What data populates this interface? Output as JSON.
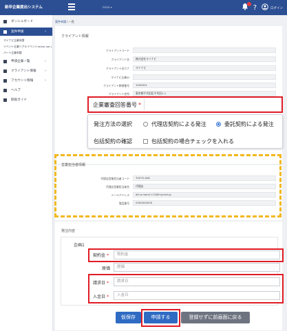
{
  "header": {
    "app_title": "新卒企業提出システム",
    "center_text": "mirai ▾",
    "help_icon": "?",
    "user_label": "ログイン"
  },
  "sidebar": {
    "items": [
      {
        "label": "ダッシュボード",
        "chevron": ""
      },
      {
        "label": "案件申請",
        "chevron": "‹"
      }
    ],
    "subitems": [
      "マイナビ企業申請",
      "イベント企業リアルイベント(mirai ver.)",
      "パート企業申請"
    ],
    "items2": [
      {
        "label": "申請企業一覧",
        "chevron": "›"
      },
      {
        "label": "クライアント情報",
        "chevron": "›"
      },
      {
        "label": "アカウント情報",
        "chevron": "›"
      },
      {
        "label": "ヘルプ",
        "chevron": ""
      },
      {
        "label": "取扱ガイド",
        "chevron": ""
      }
    ]
  },
  "breadcrumb": {
    "link": "案件申請",
    "sep": " / ",
    "current": "一覧"
  },
  "client_section": {
    "title": "クライアント情報",
    "rows": [
      {
        "label": "クライアントコード",
        "value": ""
      },
      {
        "label": "クライアント名",
        "value": "株式会社マイナビ"
      },
      {
        "label": "クライアント名カナ",
        "value": "マイナビ"
      },
      {
        "label": "マイナビ企業ID",
        "value": ""
      },
      {
        "label": "クライアント郵便番号",
        "value": "1000001"
      },
      {
        "label": "クライアント住所",
        "value": "東京都千代田区千代田1-1"
      }
    ]
  },
  "zoom_company": {
    "label": "企業審査回答番号",
    "required": "*"
  },
  "zoom_order": {
    "method_label": "発注方法の選択",
    "option_agency": "代理店契約による発注",
    "option_commission": "委託契約による発注",
    "bulk_label": "包括契約の確認",
    "bulk_checkbox": "包括契約の場合チェックを入れる"
  },
  "sales_section": {
    "title": "営業担当者情報",
    "rows": [
      {
        "label": "代理店営業担当者コード",
        "value": "70075-006"
      },
      {
        "label": "代理店営業担当者名",
        "value": "代理店"
      },
      {
        "label": "メールアドレス",
        "value": "aki.a.marui+12@mynavi.jp"
      },
      {
        "label": "電話番号",
        "value": "0300000000"
      }
    ]
  },
  "order_section": {
    "title": "発注内容",
    "plan_label": "企画1",
    "contract_label": "契約金",
    "contract_placeholder": "契約金",
    "cost_label": "原価",
    "cost_placeholder": "原価",
    "invoice_label": "請求日",
    "invoice_placeholder": "請求日",
    "payment_label": "入金日",
    "payment_placeholder": "入金日",
    "required": "*"
  },
  "buttons": {
    "draft": "仮保存",
    "apply": "申請する",
    "back": "登録せずに前画面に戻る"
  },
  "colors": {
    "header": "#2c4f93",
    "highlight_red": "#e01b24",
    "highlight_yellow": "#f2b71c",
    "primary_button": "#2f6bc3"
  },
  "icons": {
    "notifications": "bell-icon",
    "help": "question-icon",
    "user": "user-circle-icon",
    "menu": "hamburger-icon"
  }
}
